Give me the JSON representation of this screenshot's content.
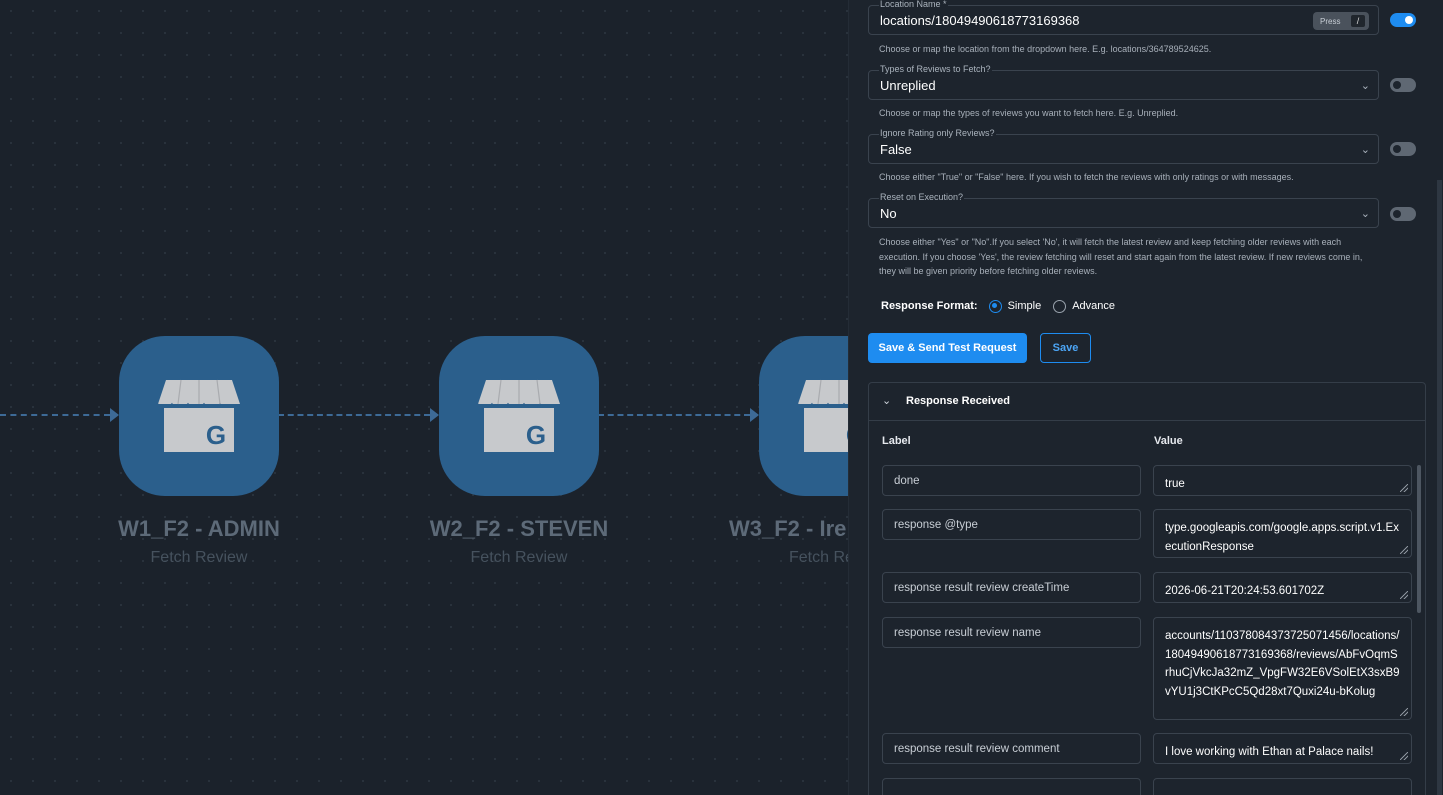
{
  "canvas": {
    "nodes": [
      {
        "title": "W1_F2 - ADMIN",
        "subtitle": "Fetch Review"
      },
      {
        "title": "W2_F2 - STEVEN",
        "subtitle": "Fetch Review"
      },
      {
        "title": "W3_F2 - Ire",
        "subtitle": "Fetch Re"
      }
    ],
    "node_icon": "google-my-business-store-icon",
    "connector_color": "#3d6a96",
    "node_color": "#2b5f8c"
  },
  "panel": {
    "fields": [
      {
        "label": "Location Name *",
        "value": "locations/18049490618773169368",
        "help": "Choose or map the location from the dropdown here. E.g. locations/364789524625.",
        "toggle_on": true,
        "press_label": "Press",
        "press_key": "/"
      },
      {
        "label": "Types of Reviews to Fetch?",
        "value": "Unreplied",
        "help": "Choose or map the types of reviews you want to fetch here. E.g. Unreplied.",
        "toggle_on": false
      },
      {
        "label": "Ignore Rating only Reviews?",
        "value": "False",
        "help": "Choose either \"True\" or \"False\" here. If you wish to fetch the reviews with only ratings or with messages.",
        "toggle_on": false
      },
      {
        "label": "Reset on Execution?",
        "value": "No",
        "help": "Choose either \"Yes\" or \"No\".If you select 'No', it will fetch the latest review and keep fetching older reviews with each execution. If you choose 'Yes', the review fetching will reset and start again from the latest review. If new reviews come in, they will be given priority before fetching older reviews.",
        "toggle_on": false
      }
    ],
    "response_format": {
      "label": "Response Format:",
      "options": [
        "Simple",
        "Advance"
      ],
      "selected": "Simple"
    },
    "buttons": {
      "test": "Save & Send Test Request",
      "save": "Save"
    },
    "response": {
      "title": "Response Received",
      "col_label": "Label",
      "col_value": "Value",
      "rows": [
        {
          "label": "done",
          "value": "true"
        },
        {
          "label": "response @type",
          "value": "type.googleapis.com/google.apps.script.v1.ExecutionResponse"
        },
        {
          "label": "response result review createTime",
          "value": "2026-06-21T20:24:53.601702Z"
        },
        {
          "label": "response result review name",
          "value": "accounts/110378084373725071456/locations/18049490618773169368/reviews/AbFvOqmSrhuCjVkcJa32mZ_VpgFW32E6VSolEtX3sxB9vYU1j3CtKPcC5Qd28xt7Quxi24u-bKolug"
        },
        {
          "label": "response result review comment",
          "value": "I love working with Ethan at Palace nails!"
        }
      ]
    },
    "accent_color": "#1e8cf0"
  }
}
